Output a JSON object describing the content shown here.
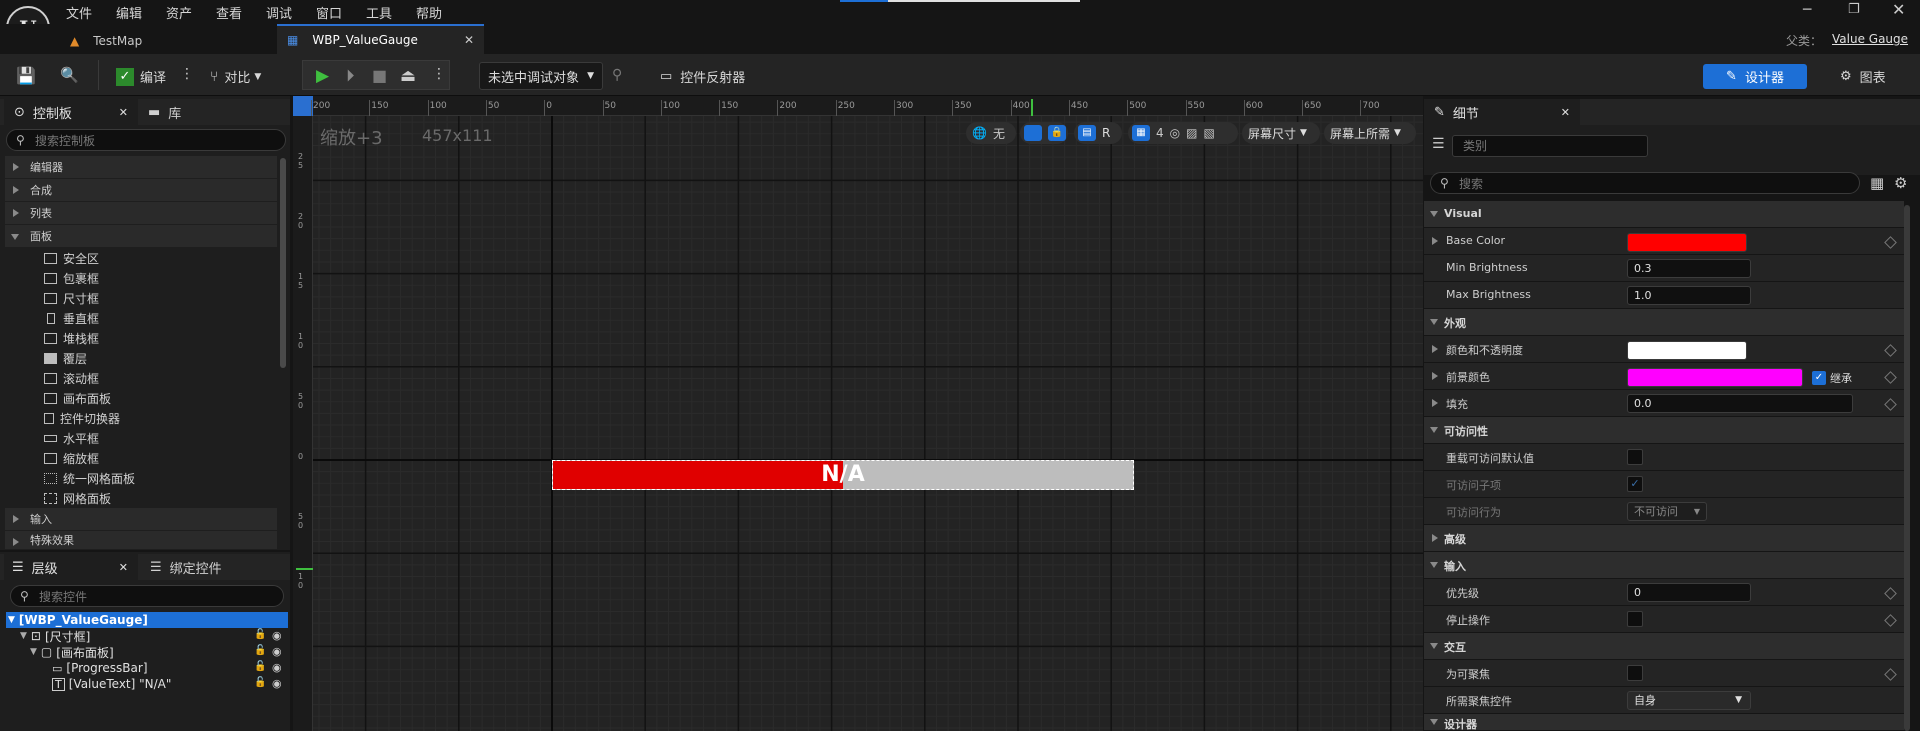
{
  "menu": [
    "文件",
    "编辑",
    "资产",
    "查看",
    "调试",
    "窗口",
    "工具",
    "帮助"
  ],
  "tabs": {
    "map": "TestMap",
    "widget": "WBP_ValueGauge"
  },
  "parent": {
    "label": "父类：",
    "value": "Value Gauge"
  },
  "toolbar": {
    "compile": "编译",
    "diff": "对比",
    "debug_target": "未选中调试对象",
    "reflector": "控件反射器",
    "designer": "设计器",
    "graph": "图表"
  },
  "palette": {
    "tab1": "控制板",
    "tab2": "库",
    "search_placeholder": "搜索控制板",
    "categories_top": [
      "编辑器",
      "合成",
      "列表",
      "面板"
    ],
    "items": [
      "安全区",
      "包裹框",
      "尺寸框",
      "垂直框",
      "堆栈框",
      "覆层",
      "滚动框",
      "画布面板",
      "控件切换器",
      "水平框",
      "缩放框",
      "统一网格面板",
      "网格面板"
    ],
    "categories_bottom": [
      "输入",
      "特殊效果"
    ]
  },
  "hierarchy": {
    "tab1": "层级",
    "tab2": "绑定控件",
    "search_placeholder": "搜索控件",
    "rows": [
      "[WBP_ValueGauge]",
      "[尺寸框]",
      "[画布面板]",
      "[ProgressBar]",
      "[ValueText] \"N/A\""
    ]
  },
  "viewport": {
    "zoom": "缩放+3",
    "size": "457x111",
    "ruler_h": [
      "200",
      "150",
      "100",
      "50",
      "0",
      "50",
      "100",
      "150",
      "200",
      "250",
      "300",
      "350",
      "400",
      "450",
      "500",
      "550",
      "600",
      "650",
      "700"
    ],
    "ruler_v": [
      "2\n5",
      "2\n0",
      "1\n5",
      "1\n0",
      "5\n0",
      "0",
      "5\n0",
      "1\n0"
    ],
    "btn_none": "无",
    "btn_r": "R",
    "grid_num": "4",
    "screen_size": "屏幕尺寸",
    "screen_fill": "屏幕上所需",
    "gauge_text": "N/A",
    "gauge_percent": 50
  },
  "details": {
    "tab": "细节",
    "class_placeholder": "类别",
    "search_placeholder": "搜索",
    "sections": {
      "visual": "Visual",
      "appearance": "外观",
      "accessibility": "可访问性",
      "advanced": "高级",
      "input": "输入",
      "interaction": "交互",
      "designer": "设计器"
    },
    "props": {
      "base_color": "Base Color",
      "min_brightness": "Min Brightness",
      "min_brightness_v": "0.3",
      "max_brightness": "Max Brightness",
      "max_brightness_v": "1.0",
      "color_opacity": "颜色和不透明度",
      "fg_color": "前景颜色",
      "inherit": "继承",
      "padding": "填充",
      "padding_v": "0.0",
      "override_access": "重载可访问默认值",
      "access_children": "可访问子项",
      "access_behavior": "可访问行为",
      "access_behavior_v": "不可访问",
      "priority": "优先级",
      "priority_v": "0",
      "stop_action": "停止操作",
      "focusable": "为可聚焦",
      "focus_widget": "所需聚焦控件",
      "focus_widget_v": "自身"
    },
    "colors": {
      "base": "#ff0000",
      "appearance": "#ffffff",
      "foreground": "#ff00ff"
    }
  }
}
